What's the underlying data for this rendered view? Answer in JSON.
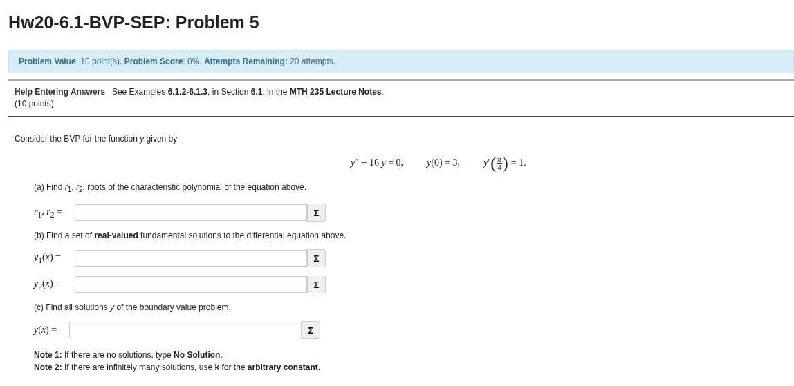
{
  "title": "Hw20-6.1-BVP-SEP: Problem 5",
  "info_bar": "**Problem Value**: 10 point(s). **Problem Score**: 0%. **Attempts Remaining:** 20 attempts.",
  "help_link": "Help Entering Answers",
  "reference": "See Examples **6.1.2**-**6.1.3**, in Section **6.1**, in the **MTH 235 Lecture Notes**.",
  "points": "(10 points)",
  "intro": "Consider the BVP for the function *y* given by",
  "equation": [
    {
      "kind": "text",
      "text": "*y*″ + 16 *y* = 0,"
    },
    {
      "kind": "text",
      "text": "*y*(0) = 3,"
    },
    {
      "kind": "frac",
      "prefix": "*y*′",
      "open": "(",
      "num": "*π*",
      "den": "4",
      "close": ")",
      "suffix": "= 1."
    }
  ],
  "parts": [
    {
      "kind": "prompt",
      "text": "(a) Find *r*$_{1}$, *r*$_{2}$, roots of the characteristic polynomial of the equation above."
    },
    {
      "kind": "field",
      "label": "*r*$_{1}$, *r*$_{2}$ =",
      "button": "Σ"
    },
    {
      "kind": "prompt",
      "text": "(b) Find a set of **real-valued** fundamental solutions to the differential equation above."
    },
    {
      "kind": "field",
      "label": "*y*$_{1}$(*x*) =",
      "button": "Σ"
    },
    {
      "kind": "field",
      "label": "*y*$_{2}$(*x*) =",
      "button": "Σ"
    },
    {
      "kind": "prompt",
      "text": "(c) Find all solutions *y* of the boundary value problem."
    },
    {
      "kind": "field",
      "label": "*y*(*x*) =",
      "button": "Σ"
    }
  ],
  "notes": [
    "**Note 1:** If there are no solutions, type **No Solution**.",
    "**Note 2:** If there are infinitely many solutions, use **k** for the **arbitrary constant**."
  ]
}
